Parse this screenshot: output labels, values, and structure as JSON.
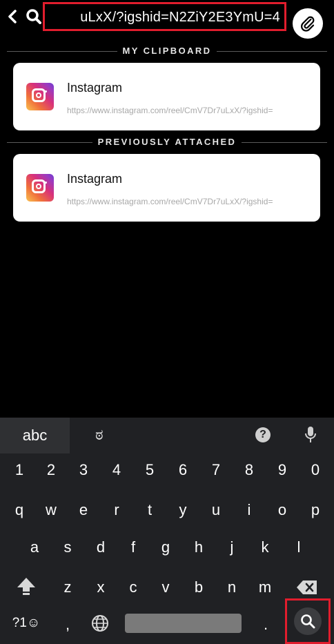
{
  "top_bar": {
    "url_text": "uLxX/?igshid=N2ZiY2E3YmU=4"
  },
  "sections": {
    "clipboard_label": "MY CLIPBOARD",
    "previous_label": "PREVIOUSLY ATTACHED"
  },
  "cards": [
    {
      "title": "Instagram",
      "url": "https://www.instagram.com/reel/CmV7Dr7uLxX/?igshid="
    },
    {
      "title": "Instagram",
      "url": "https://www.instagram.com/reel/CmV7Dr7uLxX/?igshid="
    }
  ],
  "keyboard": {
    "tab_abc": "abc",
    "tab_kannada": "ಠ",
    "help_label": "?",
    "numbers": [
      "1",
      "2",
      "3",
      "4",
      "5",
      "6",
      "7",
      "8",
      "9",
      "0"
    ],
    "row1": [
      "q",
      "w",
      "e",
      "r",
      "t",
      "y",
      "u",
      "i",
      "o",
      "p"
    ],
    "row2": [
      "a",
      "s",
      "d",
      "f",
      "g",
      "h",
      "j",
      "k",
      "l"
    ],
    "row3": [
      "z",
      "x",
      "c",
      "v",
      "b",
      "n",
      "m"
    ],
    "symbols_label": "?1☺",
    "comma": ",",
    "period": "."
  },
  "colors": {
    "highlight": "#e11d2d",
    "keyboard_bg": "#202124"
  }
}
